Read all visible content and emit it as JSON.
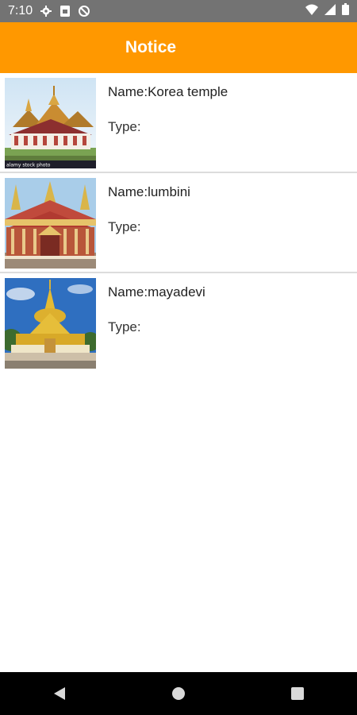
{
  "status_bar": {
    "time": "7:10",
    "left_icons": [
      "gear-icon",
      "sim-icon",
      "at-icon"
    ],
    "right_icons": [
      "wifi-icon",
      "signal-icon",
      "battery-icon"
    ]
  },
  "app_bar": {
    "title": "Notice",
    "color": "#ff9800"
  },
  "items": [
    {
      "name": "Name:Korea temple",
      "type": "Type:",
      "image": "temple-image",
      "watermark": "alamy stock photo"
    },
    {
      "name": "Name:lumbini",
      "type": "Type:",
      "image": "temple-image"
    },
    {
      "name": "Name:mayadevi",
      "type": "Type:",
      "image": "pagoda-image"
    }
  ],
  "nav_bar": {
    "buttons": [
      "back-icon",
      "home-icon",
      "recents-icon"
    ]
  }
}
